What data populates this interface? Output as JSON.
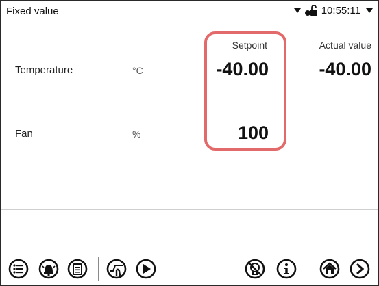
{
  "header": {
    "title": "Fixed value",
    "time": "10:55:11"
  },
  "columns": {
    "setpoint": "Setpoint",
    "actual": "Actual value"
  },
  "rows": [
    {
      "label": "Temperature",
      "unit": "°C",
      "setpoint": "-40.00",
      "actual": "-40.00"
    },
    {
      "label": "Fan",
      "unit": "%",
      "setpoint": "100",
      "actual": ""
    }
  ],
  "colors": {
    "highlight": "#e36a6a",
    "icon": "#111111"
  },
  "toolbar": {
    "icons": [
      "menu-icon",
      "alarm-icon",
      "event-list-icon",
      "graph-icon",
      "start-icon",
      "service-icon",
      "info-icon",
      "home-icon",
      "next-icon"
    ]
  }
}
